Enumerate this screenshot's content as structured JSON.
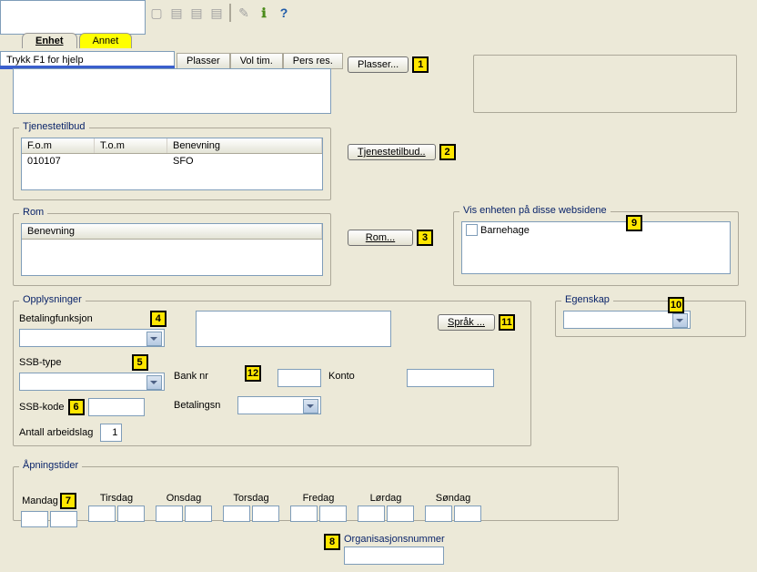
{
  "hint": "Trykk F1 for hjelp",
  "tabs": {
    "t0": "Enhet",
    "t1": "Annet"
  },
  "topcols": {
    "c0": "Plasser",
    "c1": "Vol tim.",
    "c2": "Pers res."
  },
  "panels": {
    "tjenestetilbud": "Tjenestetilbud",
    "rom": "Rom",
    "opplysninger": "Opplysninger",
    "apningstider": "Åpningstider",
    "visenheten": "Vis enheten på disse websidene",
    "egenskap": "Egenskap"
  },
  "buttons": {
    "plasser": "Plasser...",
    "tjenestetilbud": "Tjenestetilbud..",
    "rom": "Rom...",
    "sprak": "Språk ..."
  },
  "tjenesteHeaders": {
    "h0": "F.o.m",
    "h1": "T.o.m",
    "h2": "Benevning"
  },
  "tjenesteRow": {
    "c0": "010107",
    "c1": "",
    "c2": "SFO"
  },
  "romHeaders": {
    "h0": "Benevning"
  },
  "visItems": {
    "i0": "Barnehage"
  },
  "opp": {
    "betalingfunksjon": "Betalingfunksjon",
    "ssbtype": "SSB-type",
    "ssbkode": "SSB-kode",
    "antall": "Antall arbeidslag",
    "antallVal": "1",
    "banknr": "Bank nr",
    "konto": "Konto",
    "betalingsn": "Betalingsn"
  },
  "days": {
    "d0": "Mandag",
    "d1": "Tirsdag",
    "d2": "Onsdag",
    "d3": "Torsdag",
    "d4": "Fredag",
    "d5": "Lørdag",
    "d6": "Søndag"
  },
  "orgnr": "Organisasjonsnummer",
  "markers": {
    "m1": "1",
    "m2": "2",
    "m3": "3",
    "m4": "4",
    "m5": "5",
    "m6": "6",
    "m7": "7",
    "m8": "8",
    "m9": "9",
    "m10": "10",
    "m11": "11",
    "m12": "12"
  }
}
